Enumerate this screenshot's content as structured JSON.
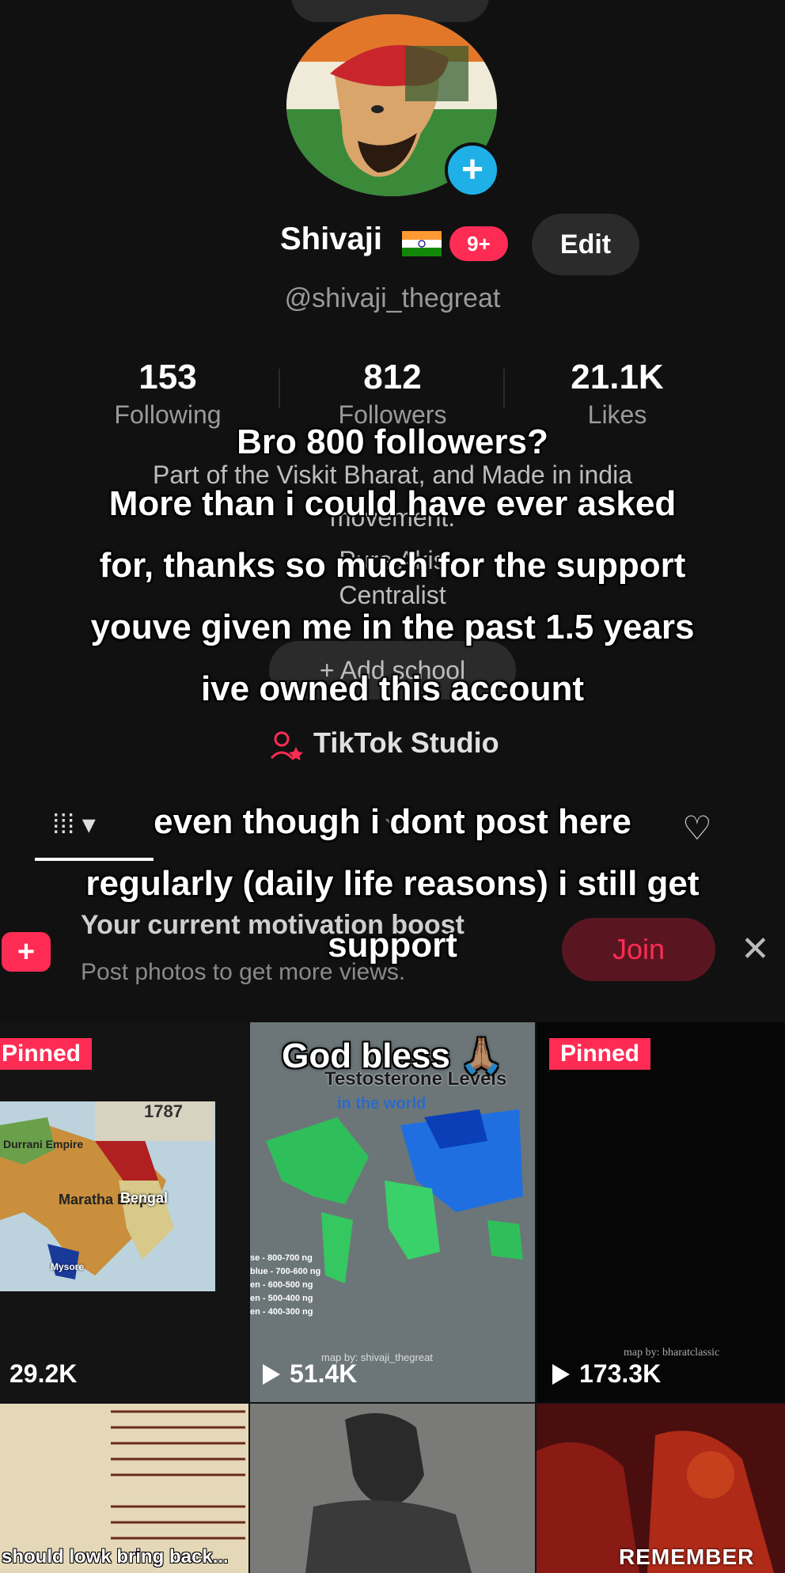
{
  "profile": {
    "display_name": "Shivaji",
    "notification_badge": "9+",
    "edit_label": "Edit",
    "username": "@shivaji_thegreat",
    "stats": [
      {
        "value": "153",
        "label": "Following"
      },
      {
        "value": "812",
        "label": "Followers"
      },
      {
        "value": "21.1K",
        "label": "Likes"
      }
    ],
    "bio_lines": [
      "Part of the Viskit Bharat, and Made in india",
      "movement.",
      "Pure Akis",
      "Centralist"
    ],
    "add_school_label": "+ Add school",
    "studio_label": "TikTok Studio"
  },
  "banner": {
    "title": "Your current motivation boost",
    "subtitle": "Post photos to get more views.",
    "join_label": "Join",
    "close_glyph": "✕",
    "plus_glyph": "+"
  },
  "videos": [
    {
      "pinned_label": "Pinned",
      "views": "29.2K",
      "thumb_year": "1787",
      "thumb_regions": [
        "Maratha Empire",
        "Bengal",
        "Durrani Empire",
        "Mysore"
      ]
    },
    {
      "views": "51.4K",
      "thumb_title": "Testosterone Levels",
      "thumb_subtitle": "in the world",
      "thumb_credit": "map by: shivaji_thegreat",
      "thumb_legend": [
        "se - 800-700 ng",
        "blue - 700-600 ng",
        "en - 600-500 ng",
        "en - 500-400 ng",
        "en - 400-300 ng"
      ]
    },
    {
      "pinned_label": "Pinned",
      "views": "173.3K",
      "thumb_credit": "map by: bharatclassic"
    }
  ],
  "bottom_row": [
    {
      "thumb_caption": "should lowk bring back..."
    },
    {
      "thumb_caption": ""
    },
    {
      "thumb_caption": "REMEMBER"
    }
  ],
  "overlay_captions": [
    "Bro 800 followers?",
    "More than i could have ever asked",
    "for, thanks so much for the support",
    "youve given me in the past 1.5 years",
    "ive owned this account",
    "even though i dont post here",
    "regularly (daily life reasons) i still get",
    "support",
    "God bless 🙏🏽"
  ],
  "colors": {
    "accent": "#fe2c55",
    "badge_blue": "#20b0e8",
    "background": "#111111"
  },
  "icons": [
    "plus-icon",
    "india-flag-icon",
    "person-add-icon",
    "grid-icon",
    "repost-icon",
    "heart-hidden-icon",
    "close-icon",
    "play-icon"
  ]
}
